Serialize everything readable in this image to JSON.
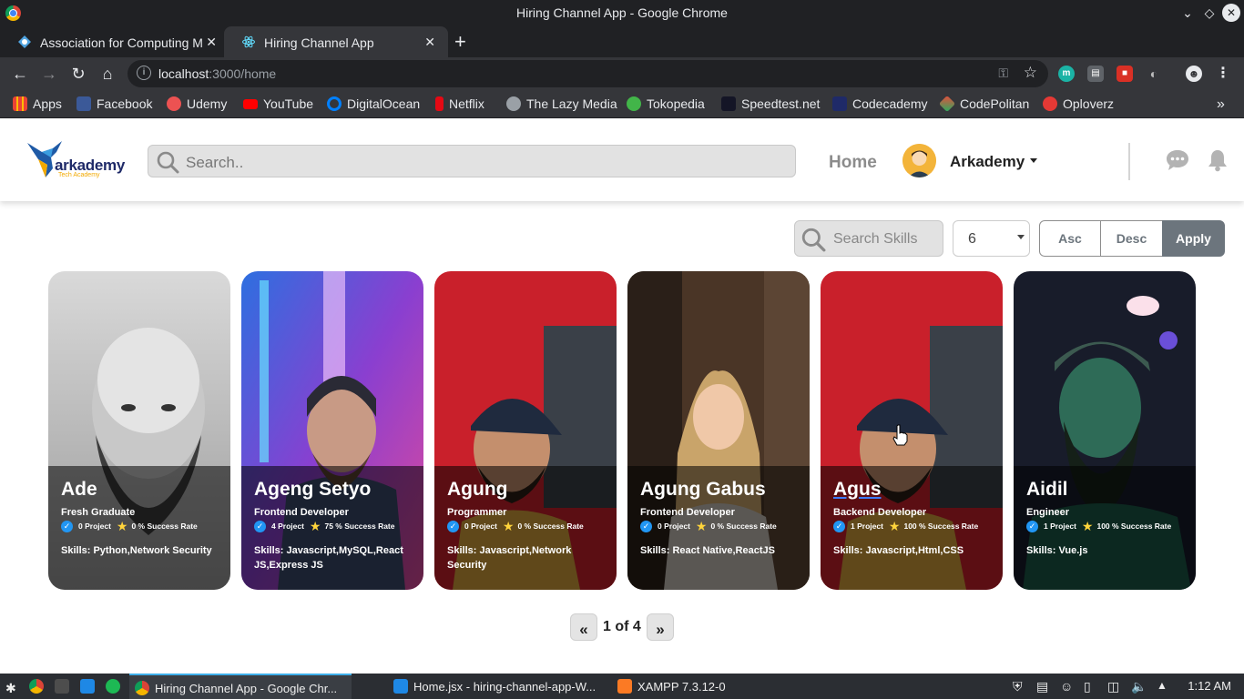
{
  "window": {
    "title": "Hiring Channel App - Google Chrome"
  },
  "tabs": [
    {
      "label": "Association for Computing M",
      "active": false
    },
    {
      "label": "Hiring Channel App",
      "active": true
    }
  ],
  "address_bar": {
    "host": "localhost",
    "path": ":3000/home"
  },
  "bookmarks": [
    {
      "label": "Apps",
      "icon": "apps-grid-icon",
      "color": "#ea4335"
    },
    {
      "label": "Facebook",
      "icon": "facebook-icon",
      "color": "#3b5998"
    },
    {
      "label": "Udemy",
      "icon": "udemy-icon",
      "color": "#ec5252"
    },
    {
      "label": "YouTube",
      "icon": "youtube-icon",
      "color": "#ff0000"
    },
    {
      "label": "DigitalOcean",
      "icon": "digitalocean-icon",
      "color": "#0080ff"
    },
    {
      "label": "Netflix",
      "icon": "netflix-icon",
      "color": "#e50914"
    },
    {
      "label": "The Lazy Media",
      "icon": "globe-icon",
      "color": "#9aa0a6"
    },
    {
      "label": "Tokopedia",
      "icon": "tokopedia-icon",
      "color": "#42b549"
    },
    {
      "label": "Speedtest.net",
      "icon": "speedtest-icon",
      "color": "#141526"
    },
    {
      "label": "Codecademy",
      "icon": "codecademy-icon",
      "color": "#1f2a68"
    },
    {
      "label": "CodePolitan",
      "icon": "codepolitan-icon",
      "color": "#e74c3c"
    },
    {
      "label": "Oploverz",
      "icon": "oploverz-icon",
      "color": "#e53935"
    }
  ],
  "navbar": {
    "brand": "arkademy",
    "tagline": "Tech Academy",
    "search_placeholder": "Search..",
    "home_label": "Home",
    "user_name": "Arkademy"
  },
  "filters": {
    "skill_search_placeholder": "Search Skills",
    "limit_value": "6",
    "asc_label": "Asc",
    "desc_label": "Desc",
    "apply_label": "Apply"
  },
  "engineers": [
    {
      "name": "Ade",
      "job": "Fresh Graduate",
      "projects": "0 Project",
      "success": "0 % Success Rate",
      "skills": "Skills: Python,Network Security"
    },
    {
      "name": "Ageng Setyo",
      "job": "Frontend Developer",
      "projects": "4 Project",
      "success": "75 % Success Rate",
      "skills": "Skills: Javascript,MySQL,React JS,Express JS"
    },
    {
      "name": "Agung",
      "job": "Programmer",
      "projects": "0 Project",
      "success": "0 % Success Rate",
      "skills": "Skills: Javascript,Network Security"
    },
    {
      "name": "Agung Gabus",
      "job": "Frontend Developer",
      "projects": "0 Project",
      "success": "0 % Success Rate",
      "skills": "Skills: React Native,ReactJS"
    },
    {
      "name": "Agus",
      "job": "Backend Developer",
      "projects": "1 Project",
      "success": "100 % Success Rate",
      "skills": "Skills: Javascript,Html,CSS"
    },
    {
      "name": "Aidil",
      "job": "Engineer",
      "projects": "1 Project",
      "success": "100 % Success Rate",
      "skills": "Skills: Vue.js"
    }
  ],
  "pagination": {
    "prev_label": "«",
    "status": "1 of 4",
    "next_label": "»"
  },
  "taskbar": {
    "items": [
      {
        "label": "Hiring Channel App - Google Chr..."
      },
      {
        "label": "Home.jsx - hiring-channel-app-W..."
      },
      {
        "label": "XAMPP 7.3.12-0"
      }
    ],
    "clock": "1:12 AM"
  }
}
